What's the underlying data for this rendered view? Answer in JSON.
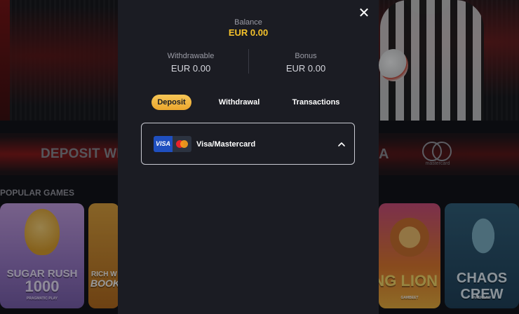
{
  "background": {
    "promo_text": "DEPOSIT WITH",
    "promo_right_text": "A",
    "promo_logo_label": "mastercard",
    "section_title": "POPULAR GAMES",
    "games": [
      {
        "title_line1": "SUGAR RUSH",
        "title_line2": "1000",
        "provider": "PRAGMATIC PLAY"
      },
      {
        "title_line1": "RICH W",
        "title_line2": "BOOK"
      },
      {
        "title_line1": "GING LION",
        "provider": "GAMBEET"
      },
      {
        "title_line1": "CHAOS CREW",
        "provider": "HACKSAW"
      }
    ]
  },
  "modal": {
    "close_icon": "close-icon",
    "balance": {
      "label": "Balance",
      "value": "EUR 0.00",
      "color": "#f5c22b"
    },
    "withdrawable": {
      "label": "Withdrawable",
      "value": "EUR 0.00"
    },
    "bonus": {
      "label": "Bonus",
      "value": "EUR 0.00"
    },
    "tabs": [
      {
        "label": "Deposit",
        "active": true
      },
      {
        "label": "Withdrawal",
        "active": false
      },
      {
        "label": "Transactions",
        "active": false
      }
    ],
    "payment_method": {
      "visa_label": "VISA",
      "label": "Visa/Mastercard",
      "expanded": true,
      "icon": "chevron-up-icon"
    }
  },
  "colors": {
    "modal_bg": "#1b1c23",
    "accent": "#f0b43d",
    "border": "#c9cad2"
  }
}
